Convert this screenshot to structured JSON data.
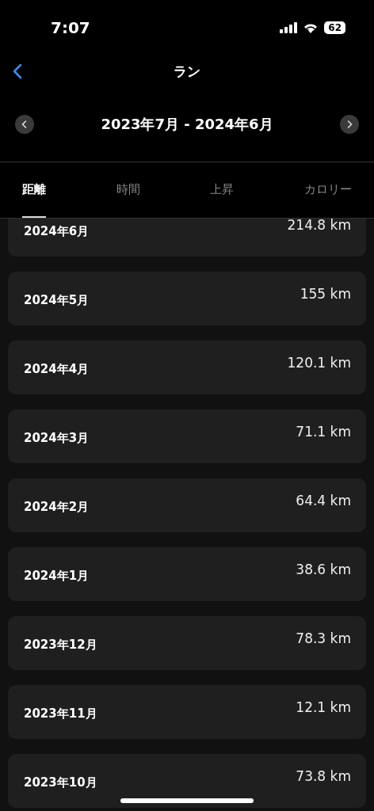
{
  "status_bar": {
    "time": "7:07",
    "battery": "62"
  },
  "nav": {
    "title": "ラン"
  },
  "range": {
    "label": "2023年7月 - 2024年6月"
  },
  "tabs": [
    {
      "label": "距離",
      "selected": true
    },
    {
      "label": "時間",
      "selected": false
    },
    {
      "label": "上昇",
      "selected": false
    },
    {
      "label": "カロリー",
      "selected": false
    }
  ],
  "rows": [
    {
      "month": "2024年6月",
      "value": "214.8 km"
    },
    {
      "month": "2024年5月",
      "value": "155 km"
    },
    {
      "month": "2024年4月",
      "value": "120.1 km"
    },
    {
      "month": "2024年3月",
      "value": "71.1 km"
    },
    {
      "month": "2024年2月",
      "value": "64.4 km"
    },
    {
      "month": "2024年1月",
      "value": "38.6 km"
    },
    {
      "month": "2023年12月",
      "value": "78.3 km"
    },
    {
      "month": "2023年11月",
      "value": "12.1 km"
    },
    {
      "month": "2023年10月",
      "value": "73.8 km"
    }
  ]
}
